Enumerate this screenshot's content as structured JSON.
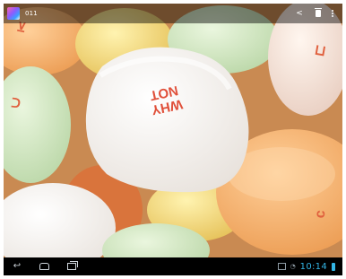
{
  "action_bar": {
    "title": "011"
  },
  "photo": {
    "candy_text_1": "NOT",
    "candy_text_2": "WHY"
  },
  "nav_bar": {
    "time": "10:14"
  },
  "colors": {
    "accent": "#33b5e5",
    "status_bg": "#000000"
  }
}
